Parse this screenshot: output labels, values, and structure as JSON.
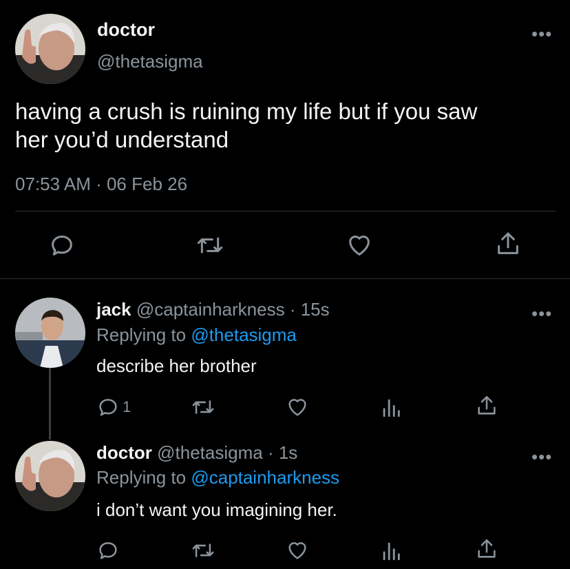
{
  "main_tweet": {
    "name": "doctor",
    "handle": "@thetasigma",
    "text_line1": "having a crush is ruining my life but if you saw",
    "text_line2": "her you’d understand",
    "timestamp": "07:53 AM · 06 Feb 26",
    "actions": [
      "reply-icon",
      "retweet-icon",
      "like-icon",
      "share-icon"
    ]
  },
  "replies": [
    {
      "name": "jack",
      "handle": "@captainharkness",
      "time": "· 15s",
      "replying_prefix": "Replying to",
      "replying_to": "@thetasigma",
      "text": "describe her brother",
      "reply_count": "1",
      "actions": [
        "reply-icon",
        "retweet-icon",
        "like-icon",
        "analytics-icon",
        "share-icon"
      ]
    },
    {
      "name": "doctor",
      "handle": "@thetasigma",
      "time": "· 1s",
      "replying_prefix": "Replying to",
      "replying_to": "@captainharkness",
      "text": "i don’t want you imagining her.",
      "actions": [
        "reply-icon",
        "retweet-icon",
        "like-icon",
        "analytics-icon",
        "share-icon"
      ]
    }
  ],
  "colors": {
    "background": "#000000",
    "text": "#e7e9ea",
    "muted": "#8b949c",
    "link": "#1d9bf0",
    "divider": "#2f3336"
  }
}
